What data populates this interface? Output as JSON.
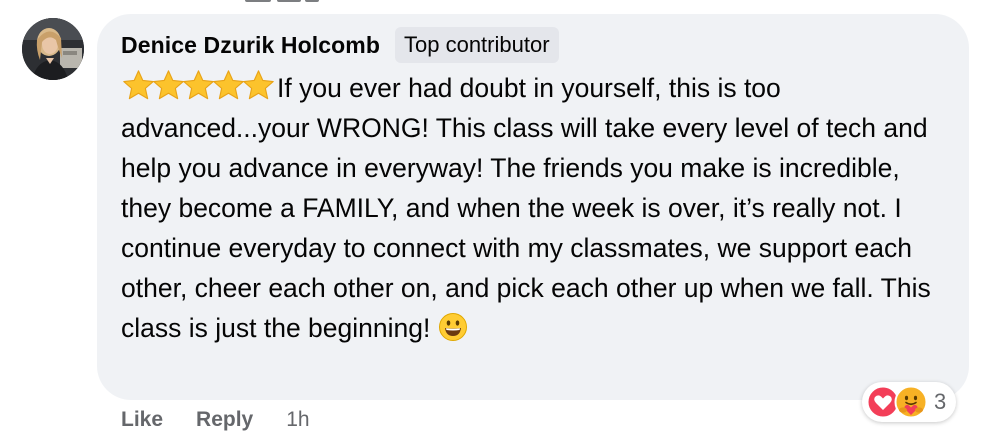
{
  "comment": {
    "author": "Denice Dzurik Holcomb",
    "badge": "Top contributor",
    "rating_icons": [
      "star-icon",
      "star-icon",
      "star-icon",
      "star-icon",
      "star-icon"
    ],
    "text": "If you ever had doubt in yourself, this is too advanced...your WRONG! This class will take every level of tech and help you advance in everyway! The friends you make is incredible, they become a FAMILY, and when the week is over, it’s really not. I continue everyday to connect with my classmates, we support each other, cheer each other on, and pick each other up when we fall. This class is just the beginning!",
    "trailing_emoji": "grinning-face-icon"
  },
  "reactions": {
    "icons": [
      "love-icon",
      "care-icon"
    ],
    "count": "3"
  },
  "actions": {
    "like": "Like",
    "reply": "Reply",
    "timestamp": "1h"
  },
  "colors": {
    "bubble": "#f0f2f5",
    "badge_bg": "#e4e6eb",
    "secondary_text": "#65676b",
    "love_red": "#f33e58",
    "star_gold": "#fcc32c"
  }
}
